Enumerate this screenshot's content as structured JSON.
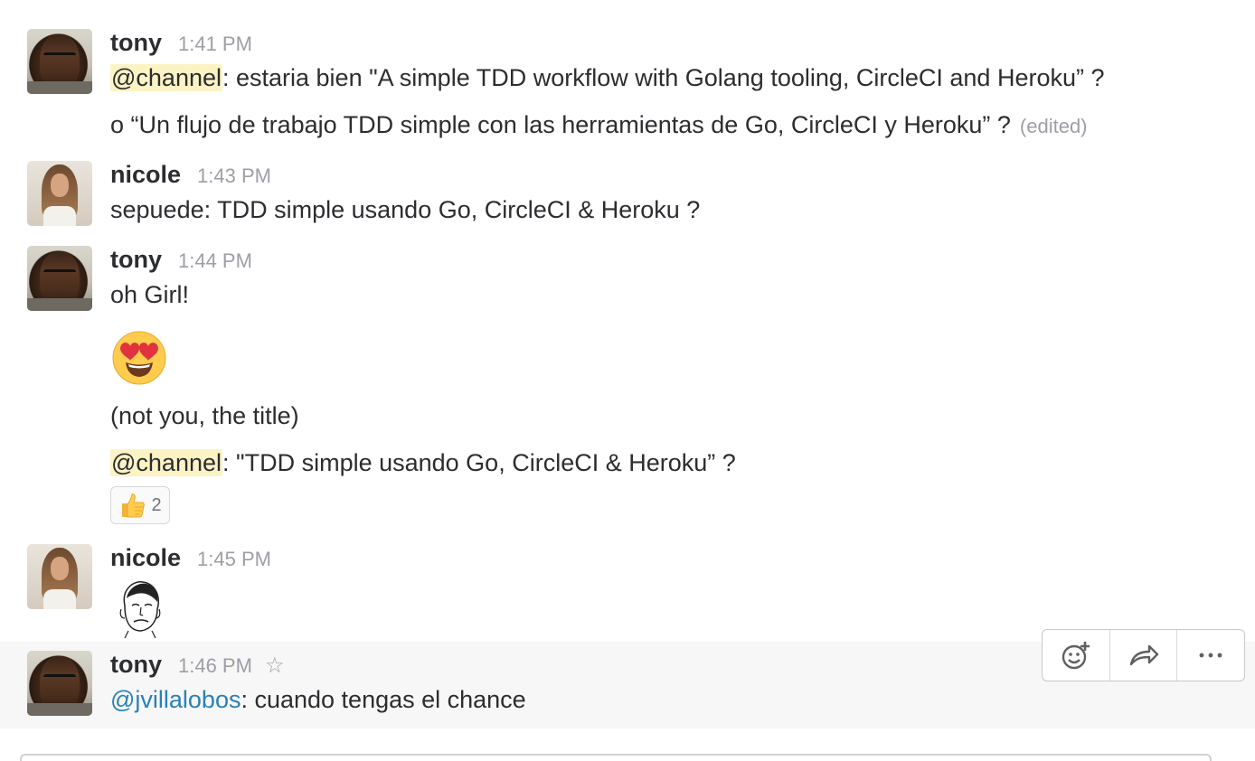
{
  "messages": [
    {
      "author": "tony",
      "time": "1:41 PM",
      "lines": {
        "l1_mention": "@channel",
        "l1_text": ": estaria bien \"A simple TDD workflow with Golang tooling, CircleCI and Heroku” ?",
        "l2_text": "o “Un flujo de trabajo TDD simple con las herramientas de Go, CircleCI  y Heroku” ?",
        "l2_edited": "(edited)"
      }
    },
    {
      "author": "nicole",
      "time": "1:43 PM",
      "lines": {
        "l1_text": "sepuede:  TDD simple usando Go, CircleCI & Heroku ?"
      }
    },
    {
      "author": "tony",
      "time": "1:44 PM",
      "lines": {
        "l1_text": "oh Girl!",
        "emoji": "heart-eyes-emoji",
        "l2_text": "(not you, the title)",
        "l3_mention": "@channel",
        "l3_text": ":  \"TDD simple usando Go, CircleCI & Heroku” ?"
      },
      "reaction": {
        "emoji": "thumbs-up-emoji",
        "count": "2"
      }
    },
    {
      "author": "nicole",
      "time": "1:45 PM",
      "attachment": "meme-face-image"
    },
    {
      "author": "tony",
      "time": "1:46 PM",
      "lines": {
        "l1_mention": "@jvillalobos",
        "l1_text": ": cuando tengas el chance"
      }
    }
  ],
  "actions": {
    "icons": [
      "add-reaction-icon",
      "share-icon",
      "more-icon"
    ]
  },
  "colors": {
    "channel_mention_bg": "#fcf3c5",
    "user_mention": "#2a80b9",
    "timestamp": "#9e9ea6"
  }
}
